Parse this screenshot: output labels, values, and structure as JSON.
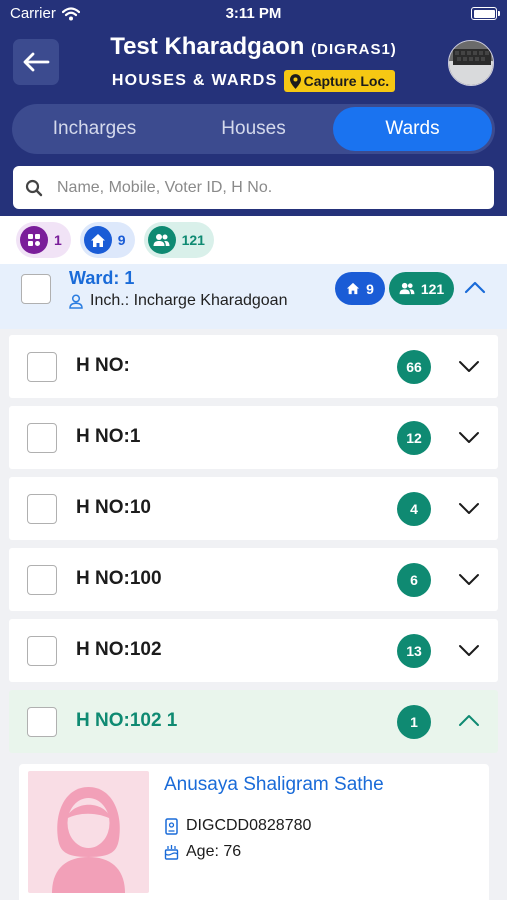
{
  "status_bar": {
    "carrier": "Carrier",
    "time": "3:11 PM"
  },
  "header": {
    "title": "Test Kharadgaon",
    "code": "(DIGRAS1)",
    "subtitle": "HOUSES & WARDS",
    "capture_label": "Capture Loc."
  },
  "tabs": [
    {
      "label": "Incharges",
      "active": false
    },
    {
      "label": "Houses",
      "active": false
    },
    {
      "label": "Wards",
      "active": true
    }
  ],
  "search": {
    "placeholder": "Name, Mobile, Voter ID, H No.",
    "value": ""
  },
  "summary": {
    "wards": "1",
    "houses": "9",
    "voters": "121"
  },
  "ward": {
    "title": "Ward: 1",
    "incharge": "Inch.: Incharge Kharadgoan",
    "houses": "9",
    "voters": "121"
  },
  "houses": [
    {
      "label": "H NO:",
      "count": "66",
      "expanded": false
    },
    {
      "label": "H NO:1",
      "count": "12",
      "expanded": false
    },
    {
      "label": "H NO:10",
      "count": "4",
      "expanded": false
    },
    {
      "label": "H NO:100",
      "count": "6",
      "expanded": false
    },
    {
      "label": "H NO:102",
      "count": "13",
      "expanded": false
    },
    {
      "label": "H NO:102 1",
      "count": "1",
      "expanded": true
    }
  ],
  "voter": {
    "name": "Anusaya Shaligram Sathe",
    "voter_id": "DIGCDD0828780",
    "age": "Age: 76"
  },
  "colors": {
    "header_bg": "#25327a",
    "active_tab": "#1a73f0",
    "accent_yellow": "#f6c813",
    "teal": "#0f8a72",
    "blue": "#1a5cd6",
    "purple": "#7a1e9a"
  }
}
